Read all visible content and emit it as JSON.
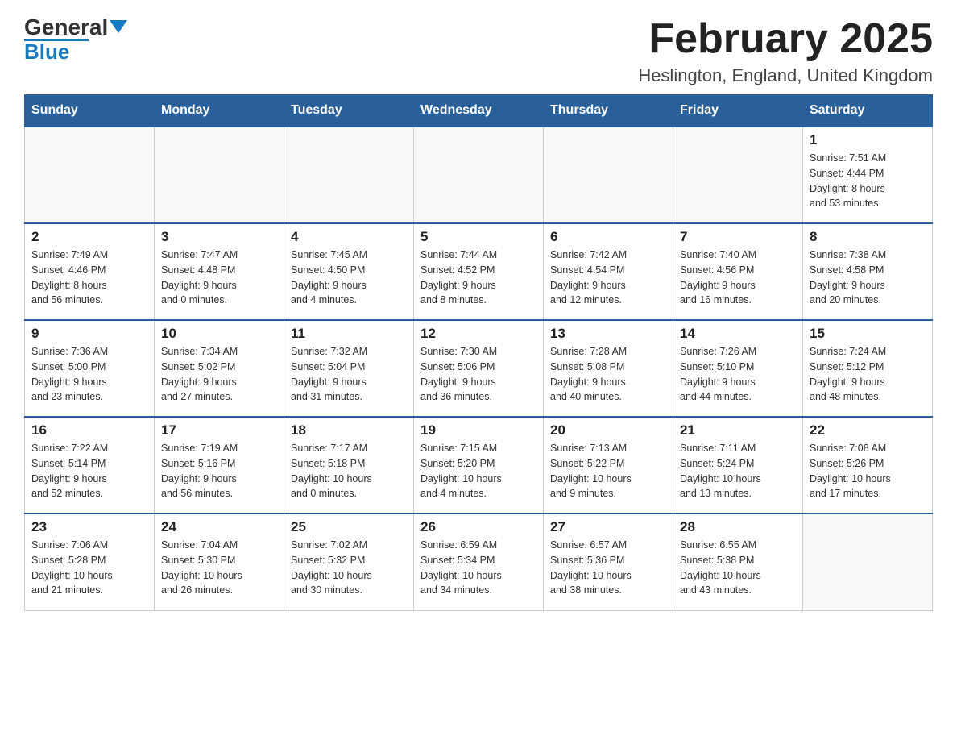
{
  "header": {
    "logo_general": "General",
    "logo_blue": "Blue",
    "month_year": "February 2025",
    "location": "Heslington, England, United Kingdom"
  },
  "weekdays": [
    "Sunday",
    "Monday",
    "Tuesday",
    "Wednesday",
    "Thursday",
    "Friday",
    "Saturday"
  ],
  "weeks": [
    [
      {
        "day": "",
        "info": ""
      },
      {
        "day": "",
        "info": ""
      },
      {
        "day": "",
        "info": ""
      },
      {
        "day": "",
        "info": ""
      },
      {
        "day": "",
        "info": ""
      },
      {
        "day": "",
        "info": ""
      },
      {
        "day": "1",
        "info": "Sunrise: 7:51 AM\nSunset: 4:44 PM\nDaylight: 8 hours\nand 53 minutes."
      }
    ],
    [
      {
        "day": "2",
        "info": "Sunrise: 7:49 AM\nSunset: 4:46 PM\nDaylight: 8 hours\nand 56 minutes."
      },
      {
        "day": "3",
        "info": "Sunrise: 7:47 AM\nSunset: 4:48 PM\nDaylight: 9 hours\nand 0 minutes."
      },
      {
        "day": "4",
        "info": "Sunrise: 7:45 AM\nSunset: 4:50 PM\nDaylight: 9 hours\nand 4 minutes."
      },
      {
        "day": "5",
        "info": "Sunrise: 7:44 AM\nSunset: 4:52 PM\nDaylight: 9 hours\nand 8 minutes."
      },
      {
        "day": "6",
        "info": "Sunrise: 7:42 AM\nSunset: 4:54 PM\nDaylight: 9 hours\nand 12 minutes."
      },
      {
        "day": "7",
        "info": "Sunrise: 7:40 AM\nSunset: 4:56 PM\nDaylight: 9 hours\nand 16 minutes."
      },
      {
        "day": "8",
        "info": "Sunrise: 7:38 AM\nSunset: 4:58 PM\nDaylight: 9 hours\nand 20 minutes."
      }
    ],
    [
      {
        "day": "9",
        "info": "Sunrise: 7:36 AM\nSunset: 5:00 PM\nDaylight: 9 hours\nand 23 minutes."
      },
      {
        "day": "10",
        "info": "Sunrise: 7:34 AM\nSunset: 5:02 PM\nDaylight: 9 hours\nand 27 minutes."
      },
      {
        "day": "11",
        "info": "Sunrise: 7:32 AM\nSunset: 5:04 PM\nDaylight: 9 hours\nand 31 minutes."
      },
      {
        "day": "12",
        "info": "Sunrise: 7:30 AM\nSunset: 5:06 PM\nDaylight: 9 hours\nand 36 minutes."
      },
      {
        "day": "13",
        "info": "Sunrise: 7:28 AM\nSunset: 5:08 PM\nDaylight: 9 hours\nand 40 minutes."
      },
      {
        "day": "14",
        "info": "Sunrise: 7:26 AM\nSunset: 5:10 PM\nDaylight: 9 hours\nand 44 minutes."
      },
      {
        "day": "15",
        "info": "Sunrise: 7:24 AM\nSunset: 5:12 PM\nDaylight: 9 hours\nand 48 minutes."
      }
    ],
    [
      {
        "day": "16",
        "info": "Sunrise: 7:22 AM\nSunset: 5:14 PM\nDaylight: 9 hours\nand 52 minutes."
      },
      {
        "day": "17",
        "info": "Sunrise: 7:19 AM\nSunset: 5:16 PM\nDaylight: 9 hours\nand 56 minutes."
      },
      {
        "day": "18",
        "info": "Sunrise: 7:17 AM\nSunset: 5:18 PM\nDaylight: 10 hours\nand 0 minutes."
      },
      {
        "day": "19",
        "info": "Sunrise: 7:15 AM\nSunset: 5:20 PM\nDaylight: 10 hours\nand 4 minutes."
      },
      {
        "day": "20",
        "info": "Sunrise: 7:13 AM\nSunset: 5:22 PM\nDaylight: 10 hours\nand 9 minutes."
      },
      {
        "day": "21",
        "info": "Sunrise: 7:11 AM\nSunset: 5:24 PM\nDaylight: 10 hours\nand 13 minutes."
      },
      {
        "day": "22",
        "info": "Sunrise: 7:08 AM\nSunset: 5:26 PM\nDaylight: 10 hours\nand 17 minutes."
      }
    ],
    [
      {
        "day": "23",
        "info": "Sunrise: 7:06 AM\nSunset: 5:28 PM\nDaylight: 10 hours\nand 21 minutes."
      },
      {
        "day": "24",
        "info": "Sunrise: 7:04 AM\nSunset: 5:30 PM\nDaylight: 10 hours\nand 26 minutes."
      },
      {
        "day": "25",
        "info": "Sunrise: 7:02 AM\nSunset: 5:32 PM\nDaylight: 10 hours\nand 30 minutes."
      },
      {
        "day": "26",
        "info": "Sunrise: 6:59 AM\nSunset: 5:34 PM\nDaylight: 10 hours\nand 34 minutes."
      },
      {
        "day": "27",
        "info": "Sunrise: 6:57 AM\nSunset: 5:36 PM\nDaylight: 10 hours\nand 38 minutes."
      },
      {
        "day": "28",
        "info": "Sunrise: 6:55 AM\nSunset: 5:38 PM\nDaylight: 10 hours\nand 43 minutes."
      },
      {
        "day": "",
        "info": ""
      }
    ]
  ]
}
